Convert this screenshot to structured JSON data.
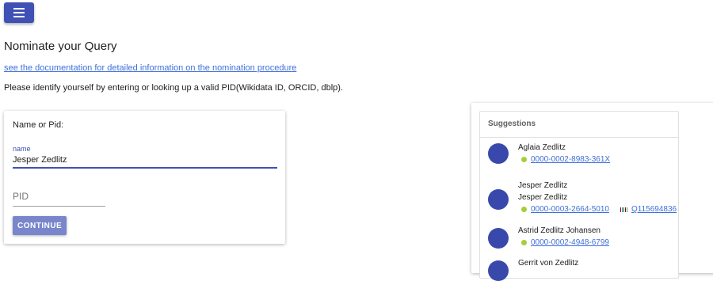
{
  "page": {
    "title": "Nominate your Query",
    "doc_link": "see the documentation for detailed information on the nomination procedure",
    "intro": "Please identify yourself by entering or looking up a valid PID(Wikidata ID, ORCID, dblp)."
  },
  "menu": {
    "icon": "menu-icon"
  },
  "form": {
    "label": "Name or Pid:",
    "name_label": "name",
    "name_value": "Jesper Zedlitz",
    "pid_placeholder": "PID",
    "continue_label": "CONTINUE"
  },
  "suggestions": {
    "title": "Suggestions",
    "items": [
      {
        "names": [
          "Aglaia Zedlitz"
        ],
        "orcid": "0000-0002-8983-361X"
      },
      {
        "names": [
          "Jesper Zedlitz",
          "Jesper Zedlitz"
        ],
        "orcid": "0000-0003-2664-5010",
        "wikidata": "Q115694836"
      },
      {
        "names": [
          "Astrid Zedlitz Johansen"
        ],
        "orcid": "0000-0002-4948-6799"
      },
      {
        "names": [
          "Gerrit von Zedlitz"
        ],
        "orcid": ""
      }
    ]
  },
  "colors": {
    "primary": "#3f51b5",
    "button_disabled": "#7986cb",
    "avatar": "#3949ab",
    "orcid": "#a6ce39",
    "link": "#3f6fd8"
  }
}
